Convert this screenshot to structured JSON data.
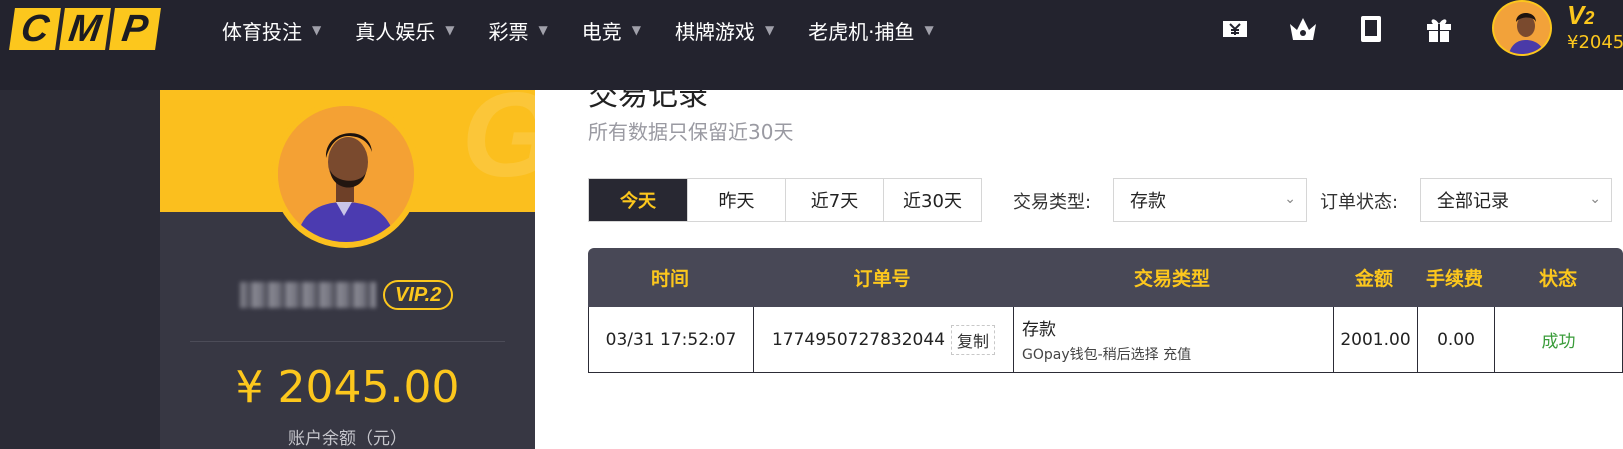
{
  "header": {
    "logo_letters": [
      "C",
      "M",
      "P"
    ],
    "nav": [
      {
        "label": "体育投注"
      },
      {
        "label": "真人娱乐"
      },
      {
        "label": "彩票"
      },
      {
        "label": "电竞"
      },
      {
        "label": "棋牌游戏"
      },
      {
        "label": "老虎机·捕鱼"
      }
    ],
    "icons": [
      "wallet-yen-icon",
      "crown-icon",
      "mobile-icon",
      "gift-icon"
    ],
    "vip_level": "V",
    "vip_number": "2",
    "balance_short": "¥2045"
  },
  "profile": {
    "vip_badge": "VIP.2",
    "balance": "¥ 2045.00",
    "balance_label": "账户余额（元）",
    "watermark": "G"
  },
  "main": {
    "title": "交易记录",
    "subtitle": "所有数据只保留近30天",
    "date_tabs": [
      "今天",
      "昨天",
      "近7天",
      "近30天"
    ],
    "active_tab": "今天",
    "type_label": "交易类型:",
    "type_value": "存款",
    "status_label": "订单状态:",
    "status_value": "全部记录"
  },
  "table": {
    "columns": [
      "时间",
      "订单号",
      "交易类型",
      "金额",
      "手续费",
      "状态"
    ],
    "rows": [
      {
        "time": "03/31 17:52:07",
        "order_no": "1774950727832044",
        "copy_label": "复制",
        "type": "存款",
        "type_detail": "GOpay钱包-稍后选择 充值",
        "amount": "2001.00",
        "fee": "0.00",
        "status": "成功"
      }
    ]
  },
  "colors": {
    "accent": "#fcc71d",
    "nav_bg": "#23232e",
    "card_bg": "#373743",
    "success": "#3a9c3a"
  }
}
